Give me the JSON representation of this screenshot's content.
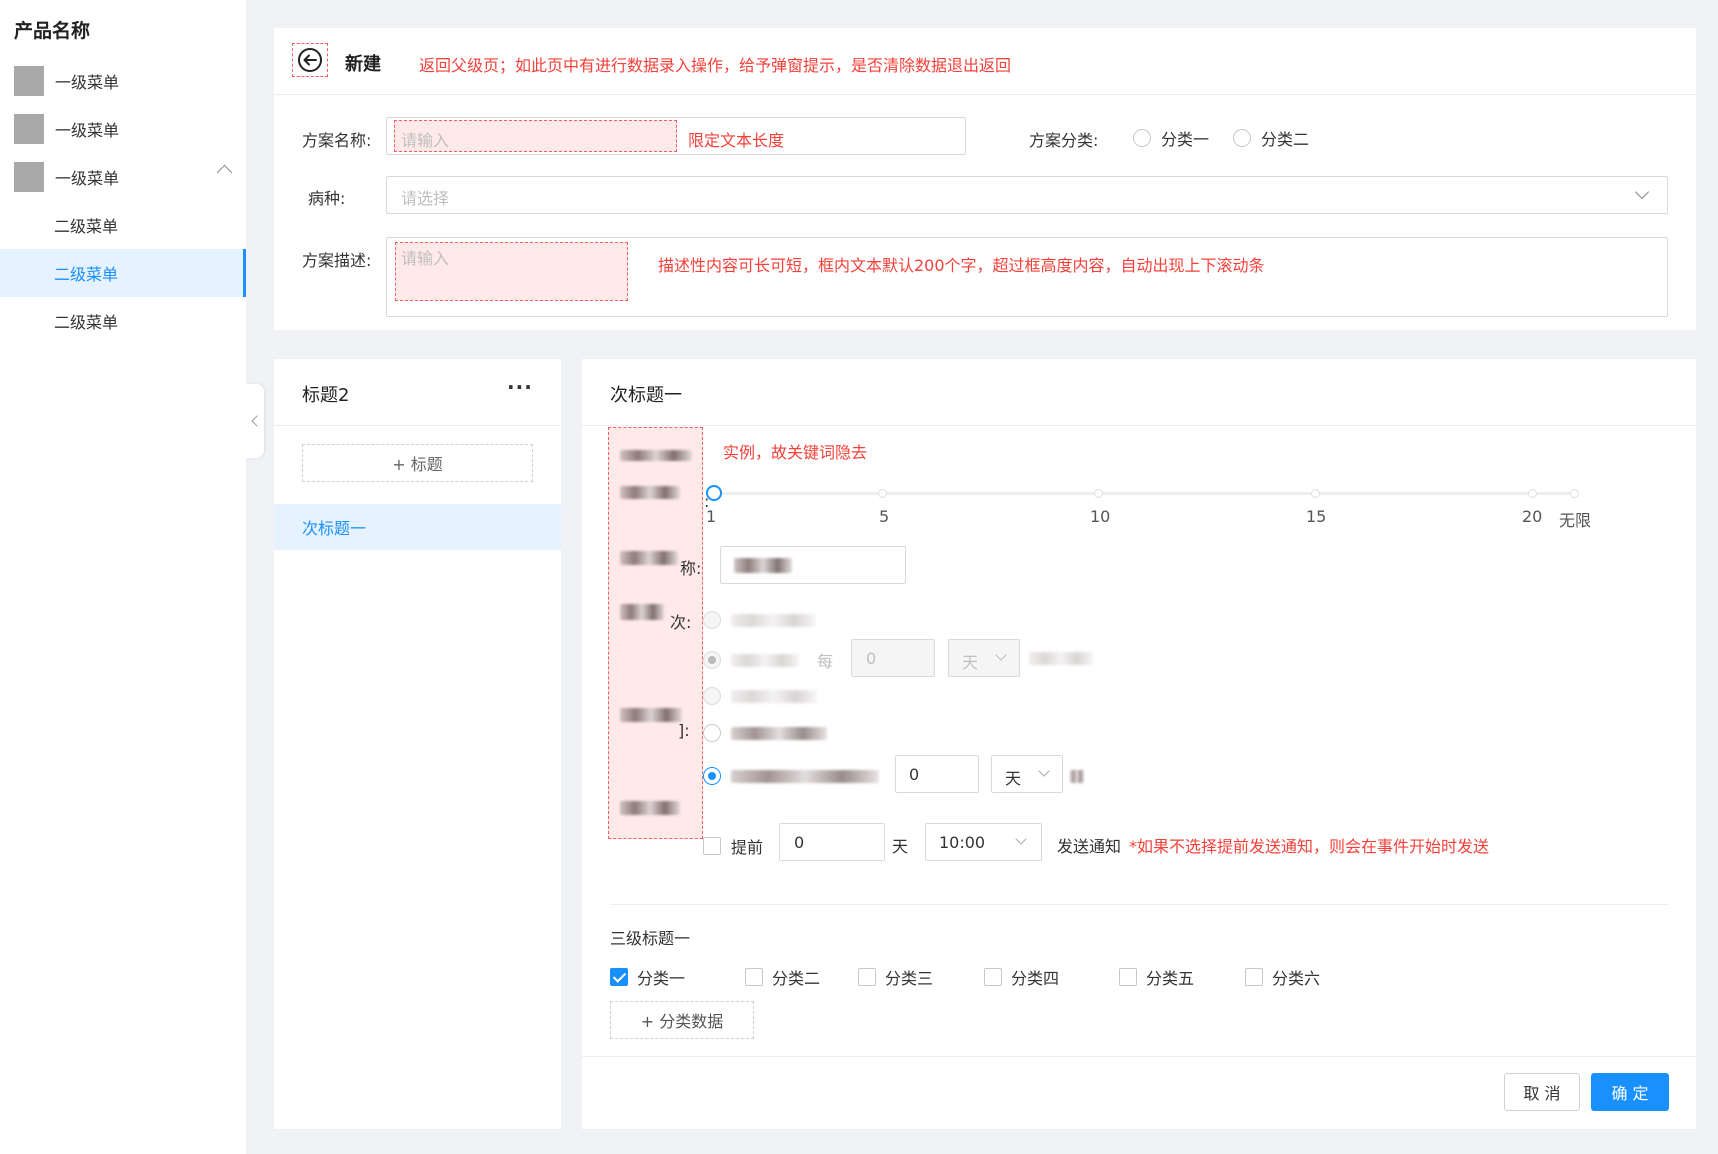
{
  "sidebar": {
    "brand": "产品名称",
    "level1": [
      "一级菜单",
      "一级菜单",
      "一级菜单"
    ],
    "level2": [
      "二级菜单",
      "二级菜单",
      "二级菜单"
    ]
  },
  "header": {
    "title": "新建",
    "note": "返回父级页；如此页中有进行数据录入操作，给予弹窗提示，是否清除数据退出返回"
  },
  "form": {
    "name_label": "方案名称:",
    "name_placeholder": "请输入",
    "name_note": "限定文本长度",
    "category_label": "方案分类:",
    "category_options": [
      "分类一",
      "分类二"
    ],
    "disease_label": "病种:",
    "disease_placeholder": "请选择",
    "desc_label": "方案描述:",
    "desc_placeholder": "请输入",
    "desc_note": "描述性内容可长可短，框内文本默认200个字，超过框高度内容，自动出现上下滚动条"
  },
  "left_panel": {
    "title": "标题2",
    "more": "···",
    "add_label": "+ 标题",
    "items": [
      "次标题一"
    ]
  },
  "right_panel": {
    "title": "次标题一",
    "note": "实例，故关键词隐去",
    "slider": {
      "ticks": [
        "1",
        "5",
        "10",
        "15",
        "20",
        "无限"
      ],
      "selected": "1"
    },
    "name_suffix": "称:",
    "name_value": "随访点",
    "freq_label": "次:",
    "freq_options": [
      "不",
      "每",
      "不"
    ],
    "every_label": "每",
    "every_value": "0",
    "unit_day": "天",
    "time_suffix": "]:",
    "time_options": [
      "手",
      "入"
    ],
    "after_value": "0",
    "notify_advance_label": "提前",
    "notify_value": "0",
    "notify_unit": "天",
    "notify_time": "10:00",
    "notify_send": "发送通知",
    "notify_note": "*如果不选择提前发送通知，则会在事件开始时发送",
    "third_title": "三级标题一",
    "categories": [
      "分类一",
      "分类二",
      "分类三",
      "分类四",
      "分类五",
      "分类六"
    ],
    "categories_checked": [
      true,
      false,
      false,
      false,
      false,
      false
    ],
    "add_category": "+ 分类数据",
    "cancel": "取 消",
    "confirm": "确 定"
  },
  "colors": {
    "primary": "#1890ff",
    "note_red": "#f5413a",
    "page_bg": "#f0f2f5"
  }
}
